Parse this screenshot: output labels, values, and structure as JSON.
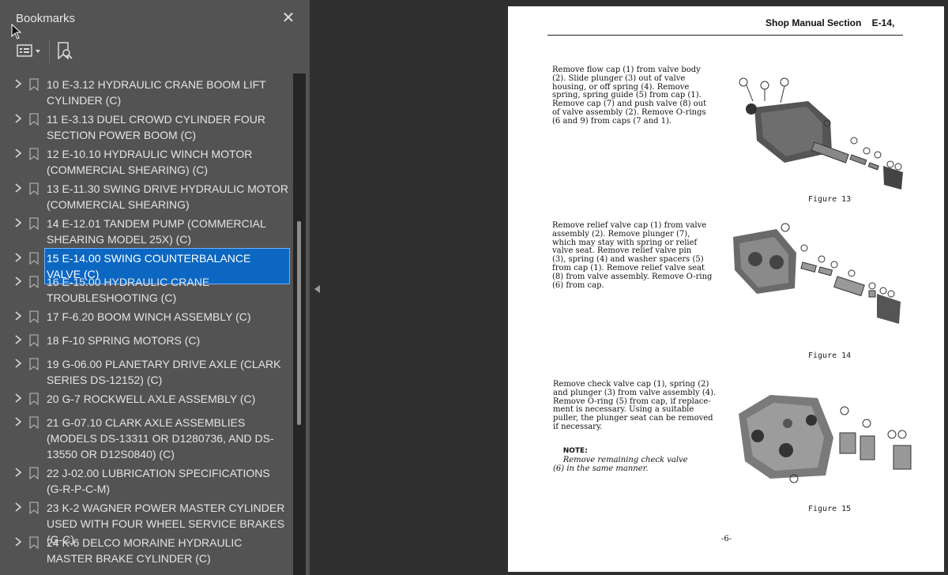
{
  "sidebar": {
    "title": "Bookmarks",
    "close_icon": "close-icon",
    "options_icon": "list-options-icon",
    "find_bookmark_icon": "bookmark-search-icon",
    "bookmarks": [
      {
        "label": "10 E-3.12 HYDRAULIC CRANE BOOM LIFT CYLINDER (C)",
        "selected": false
      },
      {
        "label": "11 E-3.13 DUEL CROWD CYLINDER FOUR SECTION POWER BOOM (C)",
        "selected": false
      },
      {
        "label": "12 E-10.10 HYDRAULIC WINCH MOTOR (COMMERCIAL SHEARING)  (C)",
        "selected": false
      },
      {
        "label": "13 E-11.30 SWING DRIVE HYDRAULIC MOTOR (COMMERCIAL SHEARING)",
        "selected": false
      },
      {
        "label": "14 E-12.01 TANDEM PUMP (COMMERCIAL SHEARING MODEL 25X) (C)",
        "selected": false
      },
      {
        "label": "15 E-14.00 SWING COUNTERBALANCE VALVE (C)",
        "selected": true
      },
      {
        "label": "16 E-15.00 HYDRAULIC CRANE TROUBLESHOOTING (C)",
        "selected": false
      },
      {
        "label": "17 F-6.20 BOOM WINCH ASSEMBLY (C)",
        "selected": false
      },
      {
        "label": "18 F-10 SPRING MOTORS (C)",
        "selected": false
      },
      {
        "label": "19 G-06.00 PLANETARY DRIVE AXLE (CLARK SERIES DS-12152) (C)",
        "selected": false
      },
      {
        "label": "20 G-7 ROCKWELL AXLE ASSEMBLY (C)",
        "selected": false
      },
      {
        "label": "21 G-07.10 CLARK AXLE ASSEMBLIES (MODELS DS-13311 OR D1280736, AND DS-13550 OR D12S0840) (C)",
        "selected": false
      },
      {
        "label": "22 J-02.00 LUBRICATION SPECIFICATIONS (G-R-P-C-M)",
        "selected": false
      },
      {
        "label": "23 K-2 WAGNER POWER MASTER CYLINDER USED WITH FOUR WHEEL SERVICE BRAKES (G-C)",
        "selected": false
      },
      {
        "label": "24 K-6 DELCO MORAINE HYDRAULIC MASTER BRAKE CYLINDER (C)",
        "selected": false
      }
    ]
  },
  "document": {
    "header": "Shop Manual Section    E-14,",
    "paragraphs": [
      "Remove flow cap (1) from valve body\n(2). Slide plunger (3) out of valve\nhousing, or off spring (4). Remove\nspring, spring guide (5) from cap (1).\nRemove cap (7) and push valve (8) out\nof valve assembly (2). Remove O-rings\n(6 and 9) from caps (7 and 1).",
      "Remove relief valve cap (1) from valve\nassembly (2). Remove plunger (7),\nwhich may stay with spring or relief\nvalve seat. Remove relief valve pin\n(3), spring (4) and washer spacers (5)\nfrom cap (1). Remove relief valve seat\n(8) from valve assembly. Remove O-ring\n(6) from cap.",
      "Remove check valve cap (1), spring (2)\nand plunger (3) from valve assembly (4).\nRemove O-ring (5) from cap, if replace-\nment is necessary. Using a suitable\npuller, the plunger seat can be removed\nif necessary."
    ],
    "note_label": "NOTE:",
    "note_text": "Remove remaining check valve\n(6) in the same manner.",
    "figures": [
      "Figure 13",
      "Figure 14",
      "Figure 15"
    ],
    "page_number": "-6-"
  }
}
